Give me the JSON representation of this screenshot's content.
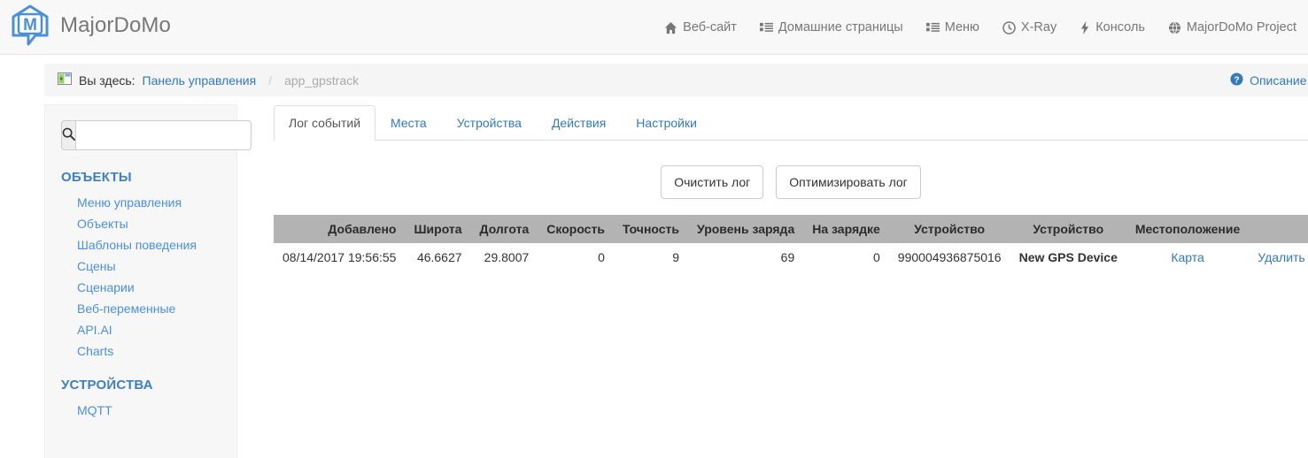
{
  "header": {
    "brand": "MajorDoMo",
    "logo_icon": "majordomo-logo-icon",
    "nav": [
      {
        "label": "Веб-сайт",
        "icon": "home-icon"
      },
      {
        "label": "Домашние страницы",
        "icon": "list-icon"
      },
      {
        "label": "Меню",
        "icon": "list-icon"
      },
      {
        "label": "X-Ray",
        "icon": "clock-icon"
      },
      {
        "label": "Консоль",
        "icon": "bolt-icon"
      },
      {
        "label": "MajorDoMo Project",
        "icon": "globe-icon"
      }
    ]
  },
  "breadcrumb": {
    "icon": "window-icon",
    "prefix": "Вы здесь:",
    "root": "Панель управления",
    "separator": "/",
    "current": "app_gpstrack",
    "help_icon": "question-circle-icon",
    "help_label": "Описание м"
  },
  "sidebar": {
    "search": {
      "icon": "search-icon",
      "value": "",
      "placeholder": ""
    },
    "groups": [
      {
        "title": "ОБЪЕКТЫ",
        "items": [
          {
            "label": "Меню управления"
          },
          {
            "label": "Объекты"
          },
          {
            "label": "Шаблоны поведения"
          },
          {
            "label": "Сцены"
          },
          {
            "label": "Сценарии"
          },
          {
            "label": "Веб-переменные"
          },
          {
            "label": "API.AI"
          },
          {
            "label": "Charts"
          }
        ]
      },
      {
        "title": "УСТРОЙСТВА",
        "items": [
          {
            "label": "MQTT"
          }
        ]
      }
    ]
  },
  "main": {
    "tabs": [
      {
        "label": "Лог событий",
        "active": true
      },
      {
        "label": "Места",
        "active": false
      },
      {
        "label": "Устройства",
        "active": false
      },
      {
        "label": "Действия",
        "active": false
      },
      {
        "label": "Настройки",
        "active": false
      }
    ],
    "buttons": [
      {
        "label": "Очистить лог"
      },
      {
        "label": "Оптимизировать лог"
      }
    ],
    "table": {
      "columns": [
        "Добавлено",
        "Широта",
        "Долгота",
        "Скорость",
        "Точность",
        "Уровень заряда",
        "На зарядке",
        "Устройство",
        "Устройство",
        "Местоположение",
        ""
      ],
      "rows": [
        {
          "added": "08/14/2017 19:56:55",
          "latitude": "46.6627",
          "longitude": "29.8007",
          "speed": "0",
          "accuracy": "9",
          "battery_level": "69",
          "charging": "0",
          "device_id": "990004936875016",
          "device_name": "New GPS Device",
          "location_link": "Карта",
          "delete_link": "Удалить"
        }
      ]
    }
  },
  "colors": {
    "accent": "#337ab7",
    "sidebar_link": "#4a90d9",
    "table_header_bg": "#b3b3b3",
    "topbar_bg": "#f8f8f8",
    "crumb_bg": "#f5f5f5"
  }
}
